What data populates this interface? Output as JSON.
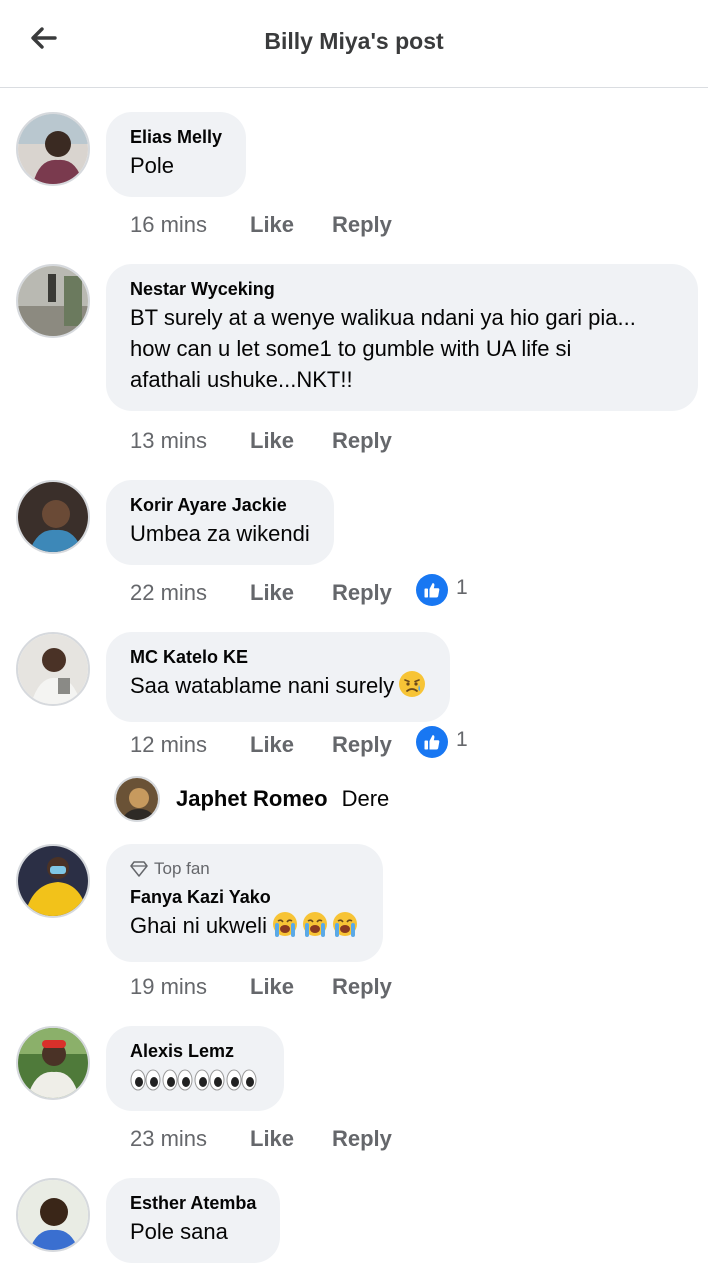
{
  "header": {
    "title": "Billy Miya's post",
    "back_icon": "arrow-left-icon"
  },
  "comments": [
    {
      "author": "Elias Melly",
      "text": "Pole",
      "time": "16 mins",
      "like_label": "Like",
      "reply_label": "Reply"
    },
    {
      "author": "Nestar Wyceking",
      "text": "BT surely at a wenye walikua ndani ya hio gari pia...\nhow can u let some1 to gumble with UA life si\nafathali ushuke...NKT!!",
      "time": "13 mins",
      "like_label": "Like",
      "reply_label": "Reply"
    },
    {
      "author": "Korir Ayare Jackie",
      "text": "Umbea za wikendi",
      "time": "22 mins",
      "like_label": "Like",
      "reply_label": "Reply",
      "reaction_count": "1"
    },
    {
      "author": "MC Katelo KE",
      "text": "Saa watablame nani surely",
      "emoji": "sad-tear-face",
      "time": "12 mins",
      "like_label": "Like",
      "reply_label": "Reply",
      "reaction_count": "1"
    },
    {
      "badge": "Top fan",
      "author": "Fanya Kazi Yako",
      "text": "Ghai ni ukweli",
      "emoji": "loudly-crying-face x3",
      "time": "19 mins",
      "like_label": "Like",
      "reply_label": "Reply"
    },
    {
      "author": "Alexis Lemz",
      "text": "",
      "emoji": "eyes x4",
      "time": "23 mins",
      "like_label": "Like",
      "reply_label": "Reply"
    },
    {
      "author": "Esther Atemba",
      "text": "Pole sana"
    }
  ],
  "reply_preview": {
    "author": "Japhet Romeo",
    "text": "Dere"
  },
  "colors": {
    "like_blue": "#1877f2",
    "bubble": "#f0f2f5",
    "secondary_text": "#65676b"
  }
}
